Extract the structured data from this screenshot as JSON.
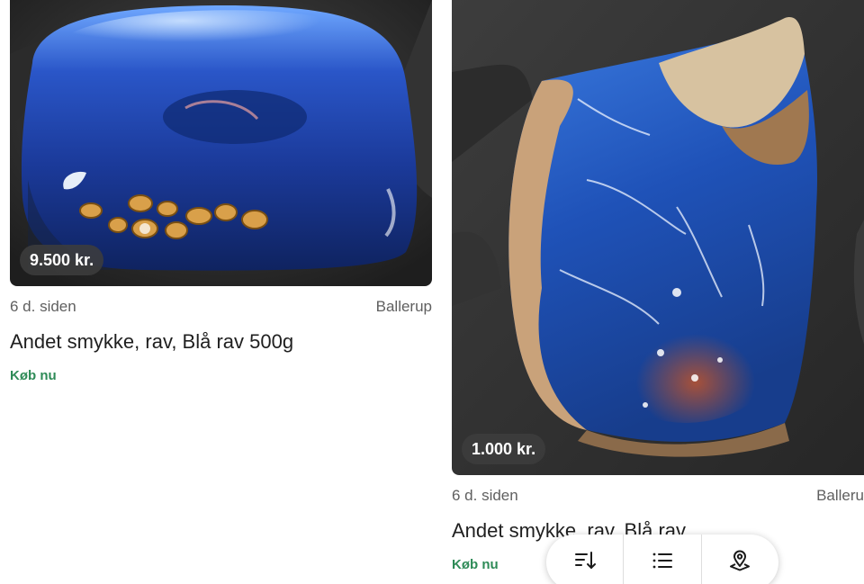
{
  "listings": [
    {
      "price": "9.500 kr.",
      "age": "6 d. siden",
      "location": "Ballerup",
      "title": "Andet smykke, rav, Blå rav 500g",
      "buy_label": "Køb nu",
      "image_icon": "blue-amber-polished-photo"
    },
    {
      "price": "1.000 kr.",
      "age": "6 d. siden",
      "location": "Balleru",
      "title": "Andet smykke, rav, Blå rav",
      "buy_label": "Køb nu",
      "image_icon": "blue-amber-raw-photo"
    }
  ],
  "toolbar": {
    "items": [
      {
        "icon": "sort-icon"
      },
      {
        "icon": "list-view-icon"
      },
      {
        "icon": "map-pin-icon"
      }
    ]
  },
  "colors": {
    "buy_green": "#2e8b57",
    "badge_bg": "#3c3c3c",
    "meta_gray": "#5f5f5f"
  }
}
